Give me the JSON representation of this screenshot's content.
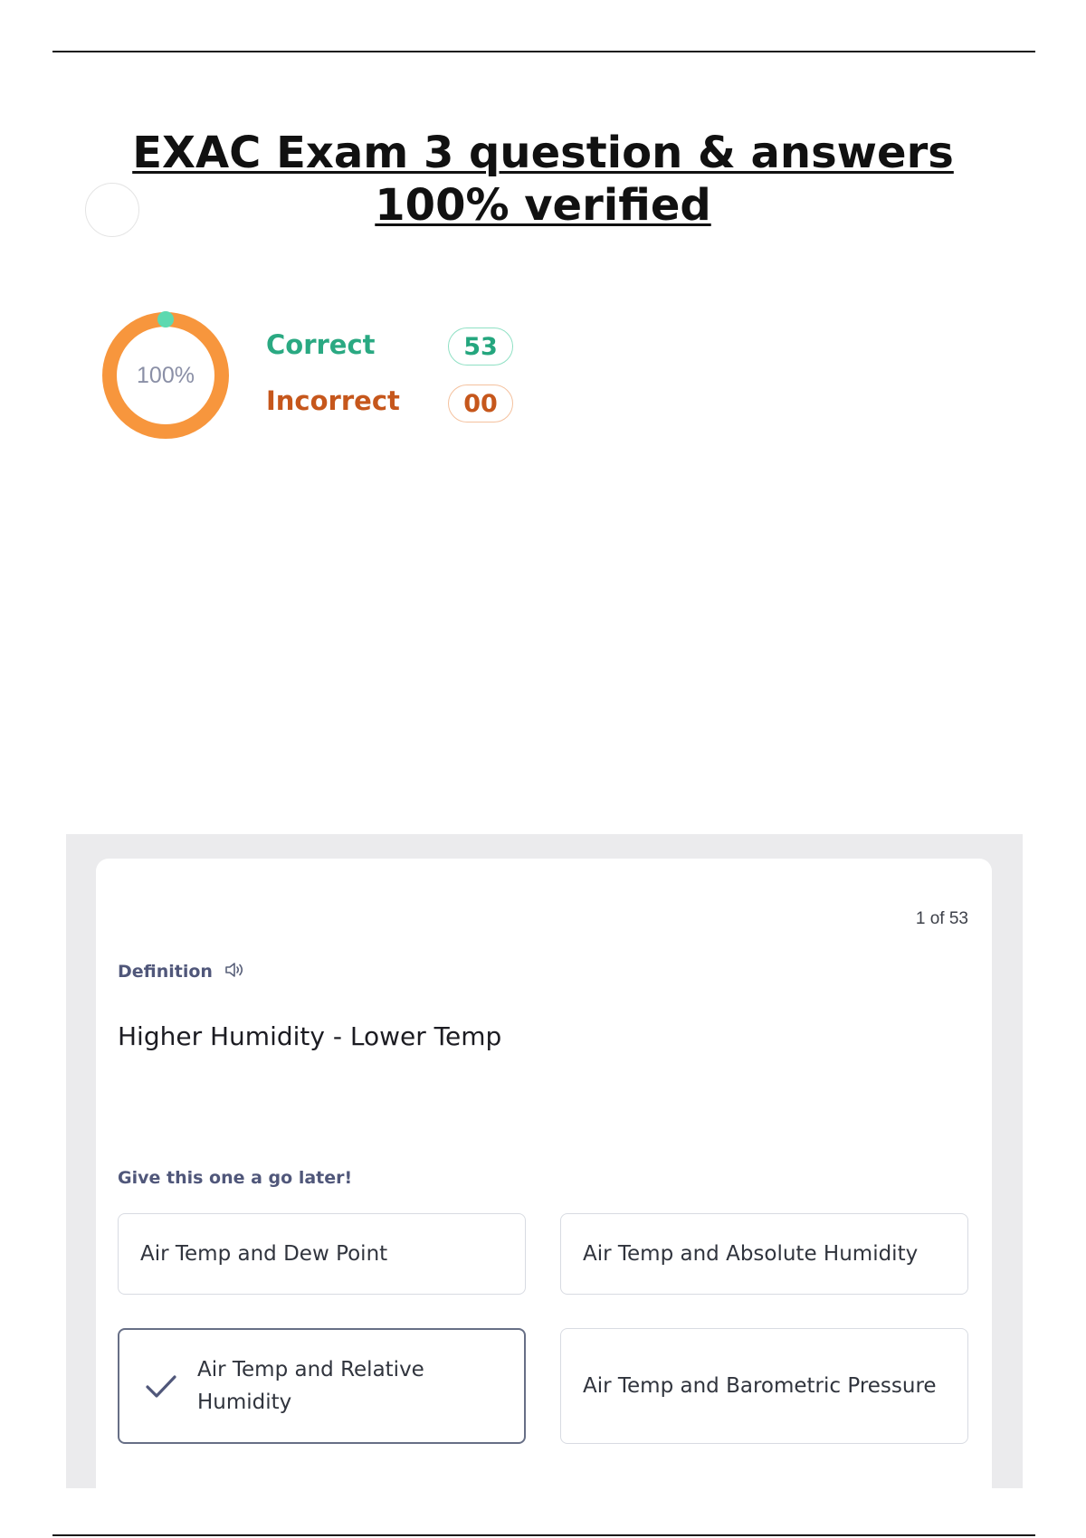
{
  "document": {
    "title_line1": "EXAC Exam 3 question & answers",
    "title_line2": "100% verified"
  },
  "score": {
    "percent_label": "100%",
    "percent_value": 100,
    "correct_label": "Correct",
    "correct_count": "53",
    "incorrect_label": "Incorrect",
    "incorrect_count": "00",
    "colors": {
      "ring": "#f7963d",
      "marker": "#5dd9b0",
      "correct": "#2aa982",
      "incorrect": "#c6571c"
    }
  },
  "card": {
    "counter": "1 of 53",
    "term_type": "Definition",
    "speaker_icon": "speaker-icon",
    "prompt": "Higher Humidity - Lower Temp",
    "later_text": "Give this one a go later!",
    "options": [
      {
        "label": "Air Temp and Dew Point",
        "selected": false
      },
      {
        "label": "Air Temp and Absolute Humidity",
        "selected": false
      },
      {
        "label": "Air Temp and Relative Humidity",
        "selected": true,
        "icon": "check-icon"
      },
      {
        "label": "Air Temp and Barometric Pressure",
        "selected": false
      }
    ]
  }
}
